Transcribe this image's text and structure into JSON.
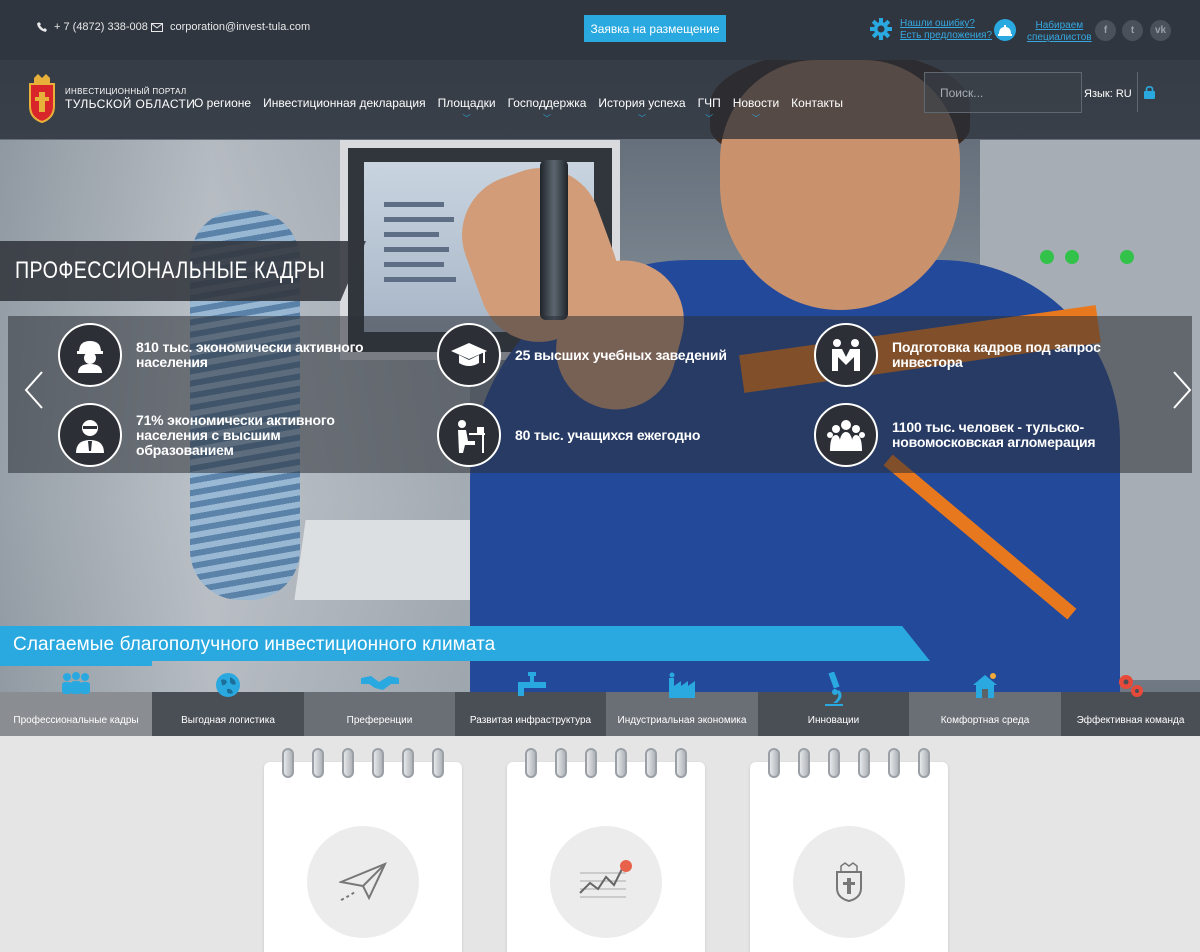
{
  "topbar": {
    "phone": "+ 7 (4872) 338-008",
    "email": "corporation@invest-tula.com",
    "apply_button": "Заявка на размещение",
    "error_link": "Нашли ошибку?",
    "suggest_link": "Есть предложения?",
    "hire_line1": "Набираем",
    "hire_line2": "специалистов",
    "social": [
      "f",
      "t",
      "vk"
    ]
  },
  "header": {
    "logo_small": "Инвестиционный портал",
    "logo_big": "Тульской области",
    "nav": [
      {
        "label": "О регионе",
        "dropdown": false
      },
      {
        "label": "Инвестиционная декларация",
        "dropdown": false
      },
      {
        "label": "Площадки",
        "dropdown": true
      },
      {
        "label": "Господдержка",
        "dropdown": true
      },
      {
        "label": "История успеха",
        "dropdown": true
      },
      {
        "label": "ГЧП",
        "dropdown": true
      },
      {
        "label": "Новости",
        "dropdown": true
      },
      {
        "label": "Контакты",
        "dropdown": false
      }
    ],
    "search_placeholder": "Поиск...",
    "language": "Язык: RU"
  },
  "hero": {
    "title": "Профессиональные кадры",
    "stats": [
      {
        "icon": "worker-helmet-icon",
        "text": "810 тыс. экономически активного населения"
      },
      {
        "icon": "graduation-cap-icon",
        "text": "25 высших учебных заведений"
      },
      {
        "icon": "handshake-people-icon",
        "text": "Подготовка кадров под запрос инвестора"
      },
      {
        "icon": "businessman-icon",
        "text": "71% экономически активного населения с высшим образованием"
      },
      {
        "icon": "student-desk-icon",
        "text": "80 тыс. учащихся ежегодно"
      },
      {
        "icon": "crowd-icon",
        "text": "1100 тыс. человек - тульско-новомосковская агломерация"
      }
    ]
  },
  "section": {
    "title": "Слагаемые благополучного инвестиционного климата",
    "tabs": [
      {
        "label": "Профессиональные кадры",
        "icon": "people-icon",
        "active": true
      },
      {
        "label": "Выгодная логистика",
        "icon": "globe-icon",
        "active": false
      },
      {
        "label": "Преференции",
        "icon": "handshake-icon",
        "active": false
      },
      {
        "label": "Развитая инфраструктура",
        "icon": "pipe-icon",
        "active": false
      },
      {
        "label": "Индустриальная экономика",
        "icon": "factory-icon",
        "active": false
      },
      {
        "label": "Инновации",
        "icon": "microscope-icon",
        "active": false
      },
      {
        "label": "Комфортная среда",
        "icon": "house-icon",
        "active": false
      },
      {
        "label": "Эффективная команда",
        "icon": "gears-icon",
        "active": false
      }
    ]
  },
  "cards": [
    {
      "icon": "paper-plane-icon"
    },
    {
      "icon": "line-chart-icon"
    },
    {
      "icon": "coat-of-arms-icon"
    }
  ],
  "colors": {
    "accent": "#2aa9e0",
    "topbar": "#2f3640",
    "tab_dark": "#4a4f56",
    "tab_mid": "#6a6e75",
    "tab_active": "#8a8d92"
  }
}
